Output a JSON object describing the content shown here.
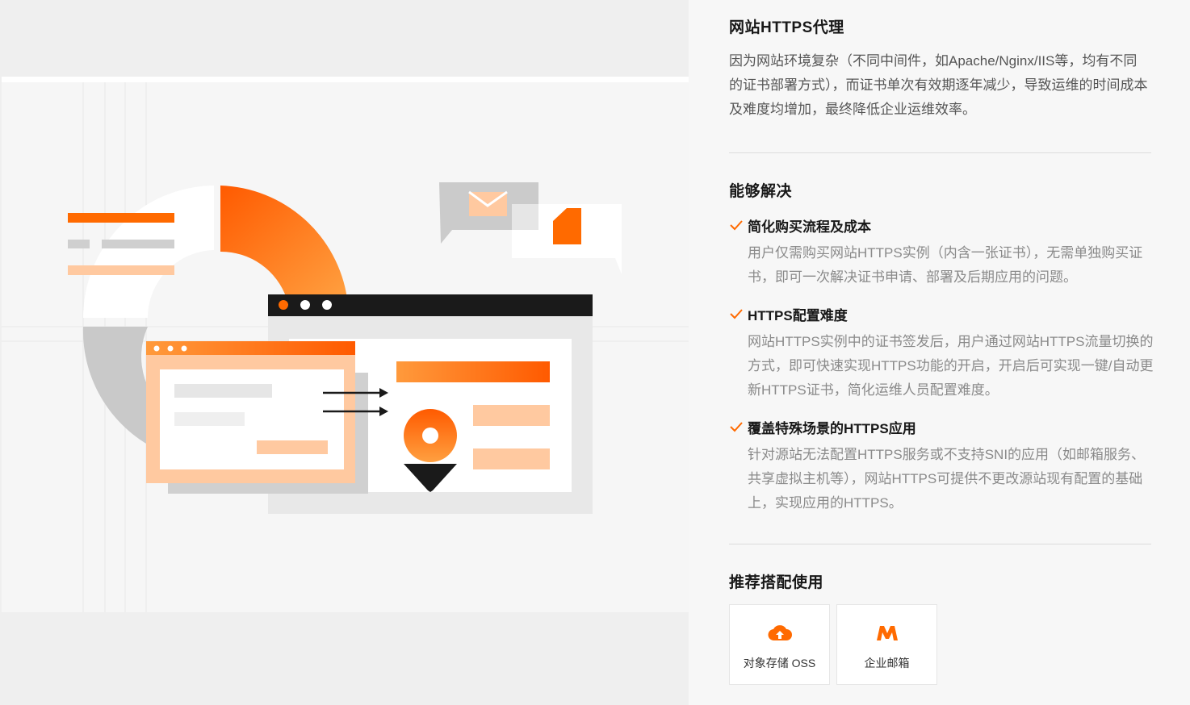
{
  "intro": {
    "title": "网站HTTPS代理",
    "description": "因为网站环境复杂（不同中间件，如Apache/Nginx/IIS等，均有不同的证书部署方式），而证书单次有效期逐年减少，导致运维的时间成本及难度均增加，最终降低企业运维效率。"
  },
  "solves": {
    "title": "能够解决",
    "items": [
      {
        "title": "简化购买流程及成本",
        "description": "用户仅需购买网站HTTPS实例（内含一张证书），无需单独购买证书，即可一次解决证书申请、部署及后期应用的问题。"
      },
      {
        "title": "HTTPS配置难度",
        "description": "网站HTTPS实例中的证书签发后，用户通过网站HTTPS流量切换的方式，即可快速实现HTTPS功能的开启，开启后可实现一键/自动更新HTTPS证书，简化运维人员配置难度。"
      },
      {
        "title": "覆盖特殊场景的HTTPS应用",
        "description": "针对源站无法配置HTTPS服务或不支持SNI的应用（如邮箱服务、共享虚拟主机等），网站HTTPS可提供不更改源站现有配置的基础上，实现应用的HTTPS。"
      }
    ]
  },
  "recommend": {
    "title": "推荐搭配使用",
    "cards": [
      {
        "label": "对象存储 OSS",
        "icon": "cloud-upload-icon"
      },
      {
        "label": "企业邮箱",
        "icon": "mail-m-icon"
      }
    ]
  },
  "colors": {
    "accent": "#ff6a00",
    "accent_light": "#ffc9a0",
    "text_primary": "#181818",
    "text_secondary": "#555555",
    "text_muted": "#8a8a8a"
  }
}
